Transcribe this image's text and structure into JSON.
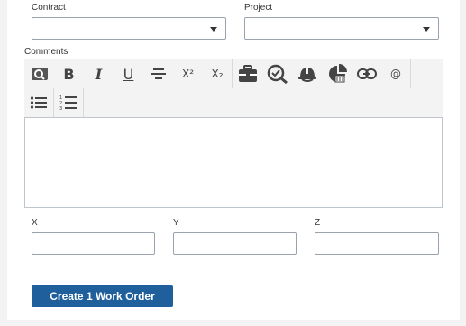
{
  "form": {
    "contract_label": "Contract",
    "project_label": "Project",
    "comments_label": "Comments",
    "x_label": "X",
    "y_label": "Y",
    "z_label": "Z",
    "x_value": "",
    "y_value": "",
    "z_value": "",
    "comments_value": ""
  },
  "toolbar": {
    "bold": "B",
    "italic": "I",
    "underline": "U",
    "superscript": "X²",
    "subscript": "X₂",
    "mention": "@"
  },
  "actions": {
    "create_label": "Create 1 Work Order"
  },
  "colors": {
    "primary": "#1e5f9c",
    "toolbar_bg": "#f3f3f3",
    "icon": "#444444"
  }
}
